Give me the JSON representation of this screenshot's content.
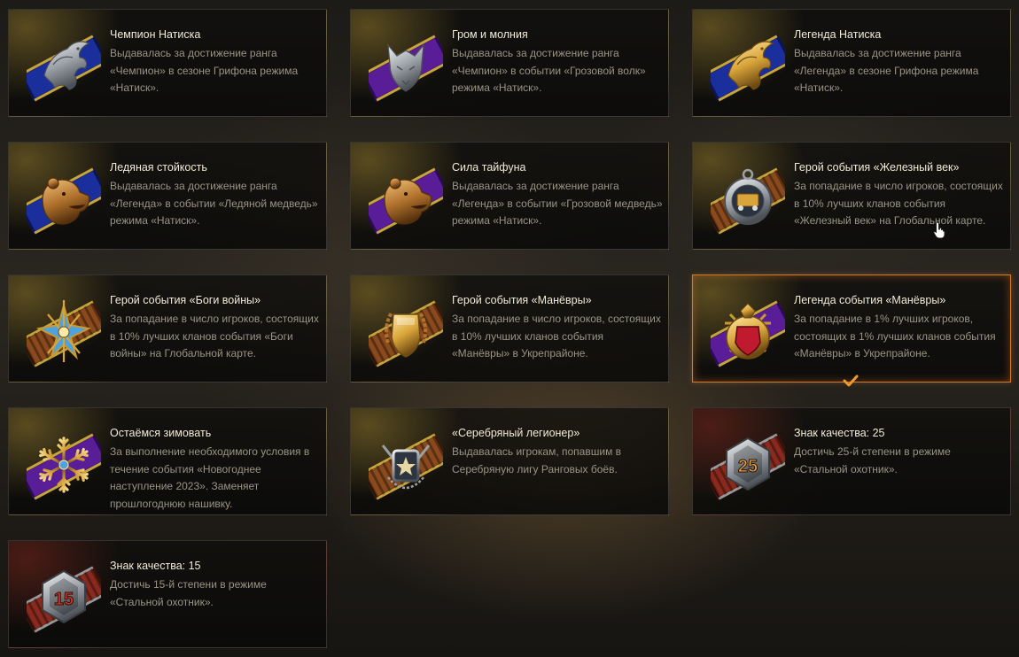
{
  "achievements": [
    {
      "title": "Чемпион Натиска",
      "desc": "Выдавалась за достижение ранга «Чемпион» в сезоне Грифона режима «Натиск».",
      "icon": "griffin-silver-icon",
      "ribbon": "blue",
      "emblem": "griffin",
      "metal": "silver"
    },
    {
      "title": "Гром и молния",
      "desc": "Выдавалась за достижение ранга «Чемпион» в событии «Грозовой волк» режима «Натиск».",
      "icon": "wolf-silver-icon",
      "ribbon": "purple",
      "emblem": "wolf",
      "metal": "silver"
    },
    {
      "title": "Легенда Натиска",
      "desc": "Выдавалась за достижение ранга «Легенда» в сезоне Грифона режима «Натиск».",
      "icon": "griffin-gold-icon",
      "ribbon": "blue",
      "emblem": "griffin",
      "metal": "gold"
    },
    {
      "title": "Ледяная стойкость",
      "desc": "Выдавалась за достижение ранга «Легенда» в событии «Ледяной медведь» режима «Натиск».",
      "icon": "bear-gold-icon",
      "ribbon": "blue",
      "emblem": "bear",
      "metal": "bronze"
    },
    {
      "title": "Сила тайфуна",
      "desc": "Выдавалась за достижение ранга «Легенда» в событии «Грозовой медведь» режима «Натиск».",
      "icon": "bear-gold-icon",
      "ribbon": "purple",
      "emblem": "bear",
      "metal": "bronze"
    },
    {
      "title": "Герой события «Железный век»",
      "desc": "За попадание в число игроков, состоящих в 10% лучших кланов события «Железный век» на Глобальной карте.",
      "icon": "train-medal-icon",
      "ribbon": "striped",
      "emblem": "train",
      "metal": "silver"
    },
    {
      "title": "Герой события «Боги войны»",
      "desc": "За попадание в число игроков, состоящих в 10% лучших кланов события «Боги войны» на Глобальной карте.",
      "icon": "war-gods-emblem-icon",
      "ribbon": "striped",
      "emblem": "star",
      "metal": "gold"
    },
    {
      "title": "Герой события «Манёвры»",
      "desc": "За попадание в число игроков, состоящих в 10% лучших кланов события «Манёвры» в Укрепрайоне.",
      "icon": "shield-laurel-icon",
      "ribbon": "striped",
      "emblem": "shield",
      "metal": "gold"
    },
    {
      "title": "Легенда события «Манёвры»",
      "desc": "За попадание в 1% лучших игроков, состоящих в 1% лучших кланов события «Манёвры» в Укрепрайоне.",
      "icon": "ruby-shield-icon",
      "ribbon": "purple",
      "emblem": "ruby",
      "metal": "gold"
    },
    {
      "title": "Остаёмся зимовать",
      "desc": "За выполнение необходимого условия в течение события «Новогоднее наступление 2023». Заменяет прошлогоднюю нашивку.",
      "icon": "snowflake-icon",
      "ribbon": "purple",
      "emblem": "snowflake",
      "metal": "gold"
    },
    {
      "title": "«Серебряный легионер»",
      "desc": "Выдавалась игрокам, попавшим в Серебряную лигу Ранговых боёв.",
      "icon": "silver-star-legion-icon",
      "ribbon": "striped",
      "emblem": "legion",
      "metal": "silver"
    },
    {
      "title": "Знак качества: 25",
      "desc": "Достичь 25-й степени в режиме «Стальной охотник».",
      "icon": "quality-25-badge-icon",
      "ribbon": "red",
      "emblem": "hex",
      "metal": "silver",
      "number": "25",
      "number_color": "#e8a14a"
    },
    {
      "title": "Знак качества: 15",
      "desc": "Достичь 15-й степени в режиме «Стальной охотник».",
      "icon": "quality-15-badge-icon",
      "ribbon": "red",
      "emblem": "hex",
      "metal": "silver",
      "number": "15",
      "number_color": "#d8342c"
    }
  ],
  "colors": {
    "card_glow_gold": "#6b5a24",
    "card_glow_red": "#5a1f18",
    "active_border": "#d67a2a",
    "title_text": "#f1ead8",
    "desc_text": "#9a9487"
  }
}
